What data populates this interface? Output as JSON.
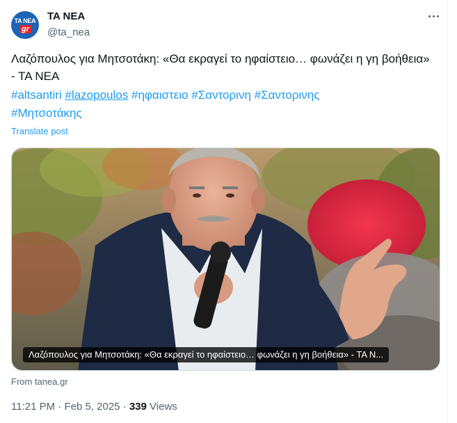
{
  "author": {
    "display_name": "TA NEA",
    "handle": "@ta_nea",
    "avatar_text_top": "TA NEA",
    "avatar_text_bottom": "gr"
  },
  "post": {
    "text": "Λαζόπουλος για Μητσοτάκη: «Θα εκραγεί το ηφαίστειο… φωνάζει η γη βοήθεια» - ΤΑ ΝΕΑ",
    "hashtags": [
      "#altsantiri",
      "#lazopoulos",
      "#ηφαιστειο",
      "#Σαντορινη",
      "#Σαντορινης",
      "#Μητσοτάκης"
    ],
    "translate_label": "Translate post",
    "card_caption": "Λαζόπουλος για Μητσοτάκη: «Θα εκραγεί το ηφαίστειο… φωνάζει η γη βοήθεια» - ΤΑ Ν...",
    "source": "From tanea.gr"
  },
  "meta": {
    "time": "11:21 PM",
    "separator": "·",
    "date": "Feb 5, 2025",
    "views_count": "339",
    "views_label": "Views"
  },
  "colors": {
    "link": "#1d9bf0",
    "secondary_text": "#536471",
    "avatar_bg": "#1c64b4"
  },
  "icons": {
    "more": "more-dots-icon"
  }
}
